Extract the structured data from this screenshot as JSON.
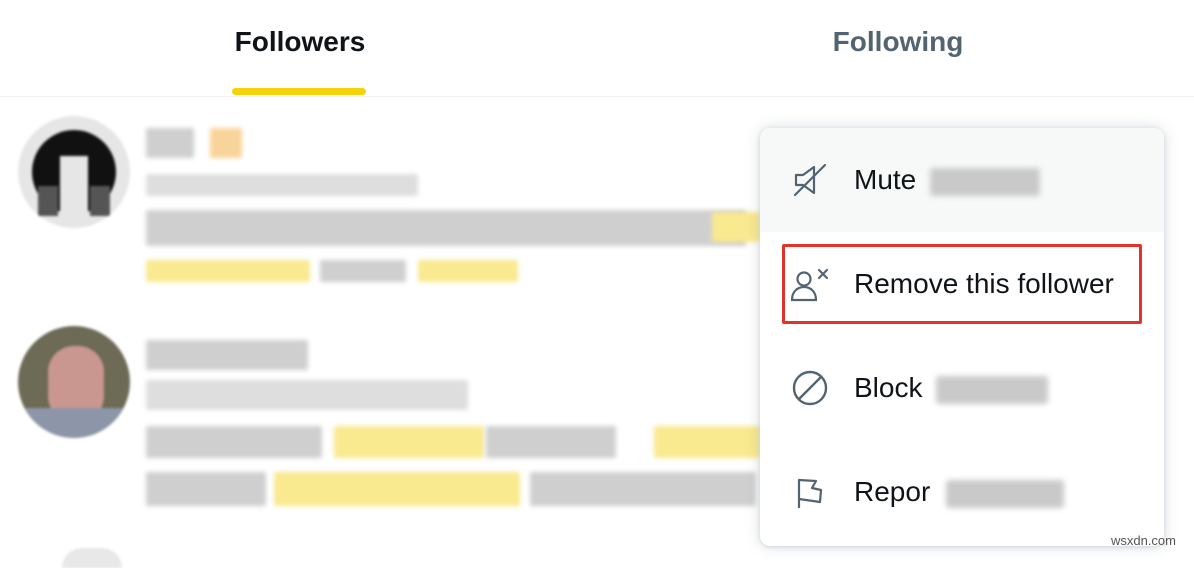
{
  "tabs": [
    {
      "label": "Followers",
      "active": true
    },
    {
      "label": "Following",
      "active": false
    }
  ],
  "colors": {
    "tab_indicator": "#f5d30b",
    "highlight_border": "#e2332b",
    "secondary_text": "#536471",
    "primary_text": "#0f1419"
  },
  "menu": {
    "items": [
      {
        "label": "Mute",
        "icon": "mute-speaker-icon"
      },
      {
        "label": "Remove this follower",
        "icon": "remove-user-icon"
      },
      {
        "label": "Block",
        "icon": "block-icon"
      },
      {
        "label": "Repor",
        "icon": "flag-icon"
      }
    ]
  },
  "watermark": "wsxdn.com"
}
